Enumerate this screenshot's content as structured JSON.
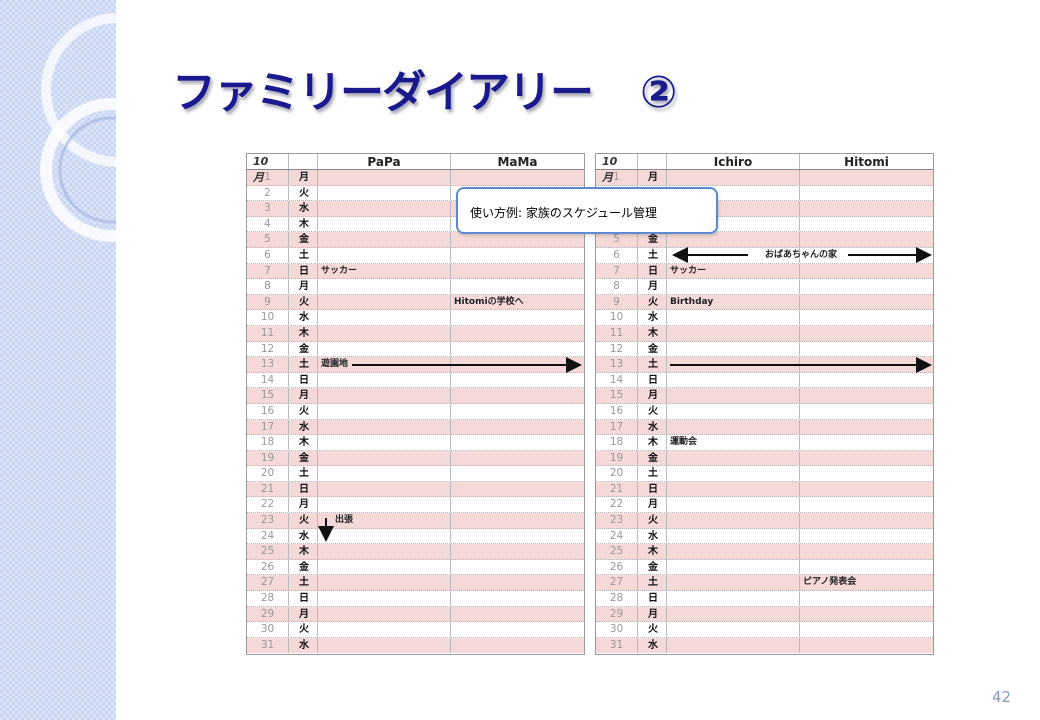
{
  "slide": {
    "title": "ファミリーダイアリー",
    "title_number": "②",
    "page_number": "42"
  },
  "callout": {
    "text": "使い方例: 家族のスケジュール管理"
  },
  "calendar_left": {
    "month_label": "10　月",
    "col_a": "PaPa",
    "col_b": "MaMa"
  },
  "calendar_right": {
    "month_label": "10　月",
    "col_a": "Ichiro",
    "col_b": "Hitomi"
  },
  "days": [
    {
      "d": "1",
      "w": "月"
    },
    {
      "d": "2",
      "w": "火"
    },
    {
      "d": "3",
      "w": "水"
    },
    {
      "d": "4",
      "w": "木"
    },
    {
      "d": "5",
      "w": "金"
    },
    {
      "d": "6",
      "w": "土"
    },
    {
      "d": "7",
      "w": "日"
    },
    {
      "d": "8",
      "w": "月"
    },
    {
      "d": "9",
      "w": "火"
    },
    {
      "d": "10",
      "w": "水"
    },
    {
      "d": "11",
      "w": "木"
    },
    {
      "d": "12",
      "w": "金"
    },
    {
      "d": "13",
      "w": "土"
    },
    {
      "d": "14",
      "w": "日"
    },
    {
      "d": "15",
      "w": "月"
    },
    {
      "d": "16",
      "w": "火"
    },
    {
      "d": "17",
      "w": "水"
    },
    {
      "d": "18",
      "w": "木"
    },
    {
      "d": "19",
      "w": "金"
    },
    {
      "d": "20",
      "w": "土"
    },
    {
      "d": "21",
      "w": "日"
    },
    {
      "d": "22",
      "w": "月"
    },
    {
      "d": "23",
      "w": "火"
    },
    {
      "d": "24",
      "w": "水"
    },
    {
      "d": "25",
      "w": "木"
    },
    {
      "d": "26",
      "w": "金"
    },
    {
      "d": "27",
      "w": "土"
    },
    {
      "d": "28",
      "w": "日"
    },
    {
      "d": "29",
      "w": "月"
    },
    {
      "d": "30",
      "w": "火"
    },
    {
      "d": "31",
      "w": "水"
    }
  ],
  "events_left": [
    {
      "day": 7,
      "col": "a",
      "text": "サッカー"
    },
    {
      "day": 9,
      "col": "b",
      "text": "Hitomiの学校へ"
    },
    {
      "day": 13,
      "col": "a",
      "text": "遊園地"
    },
    {
      "day": 23,
      "col": "a",
      "text": "出張"
    }
  ],
  "events_right": [
    {
      "day": 6,
      "col": "a",
      "text": "おばあちゃんの家"
    },
    {
      "day": 7,
      "col": "a",
      "text": "サッカー"
    },
    {
      "day": 9,
      "col": "a",
      "text": "Birthday"
    },
    {
      "day": 18,
      "col": "a",
      "text": "運動会"
    },
    {
      "day": 27,
      "col": "b",
      "text": "ピアノ発表会"
    }
  ]
}
